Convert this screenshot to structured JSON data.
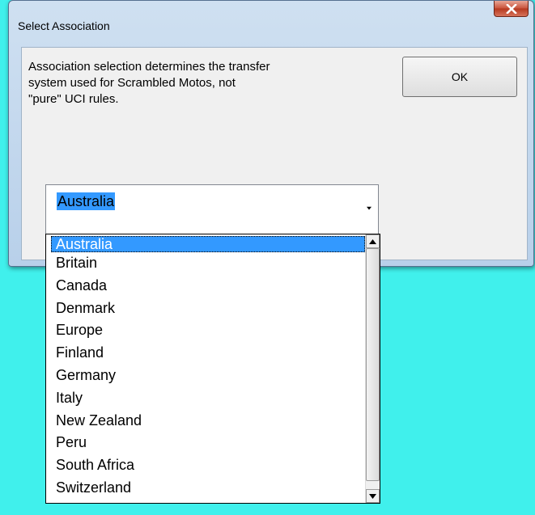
{
  "window": {
    "title": "Select Association"
  },
  "message": "Association selection determines the transfer\nsystem used for Scrambled Motos, not\n\"pure\" UCI rules.",
  "ok_button": "OK",
  "combo": {
    "value": "Australia"
  },
  "dropdown": {
    "items": [
      "Australia",
      "Britain",
      "Canada",
      "Denmark",
      "Europe",
      "Finland",
      "Germany",
      "Italy",
      "New Zealand",
      "Peru",
      "South Africa",
      "Switzerland"
    ],
    "selected_index": 0
  },
  "colors": {
    "desktop": "#40f0ec",
    "selection": "#3399ff",
    "close_button": "#c8523a"
  },
  "icons": [
    "close-icon",
    "dropdown-arrow-icon",
    "scroll-up-icon",
    "scroll-down-icon"
  ]
}
